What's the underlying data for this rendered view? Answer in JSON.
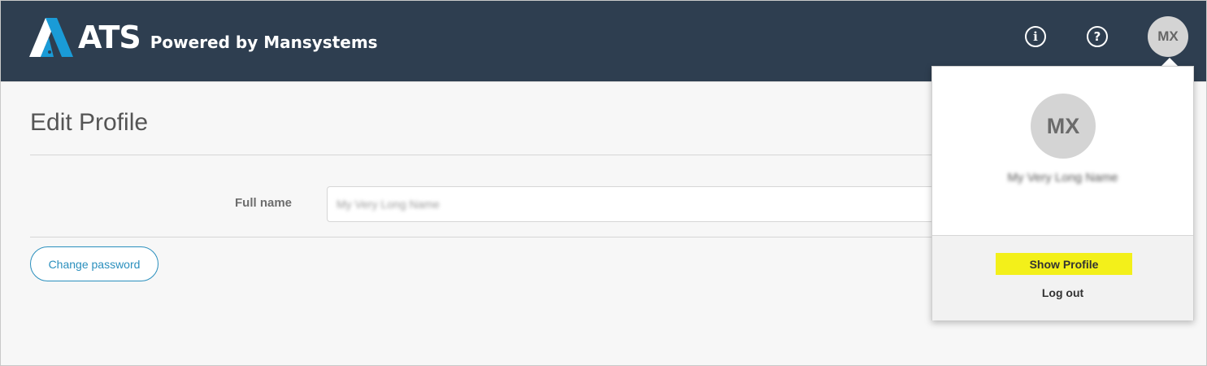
{
  "header": {
    "logo_text": "ATS",
    "logo_subtitle": "Powered by Mansystems",
    "info_icon": "i",
    "help_icon": "?",
    "avatar_initials": "MX"
  },
  "page": {
    "title": "Edit Profile",
    "full_name_label": "Full name",
    "full_name_value": "My Very Long Name",
    "change_password_label": "Change password"
  },
  "profile_menu": {
    "avatar_initials": "MX",
    "user_name": "My Very Long Name",
    "show_profile_label": "Show Profile",
    "logout_label": "Log out"
  },
  "colors": {
    "header_bg": "#2e3e50",
    "accent": "#2a8fbd",
    "highlight": "#f3f01a",
    "logo_blue": "#1a9bd7"
  },
  "icons": {
    "logo": "ats-logo-mark",
    "info": "info-icon",
    "help": "help-icon"
  }
}
